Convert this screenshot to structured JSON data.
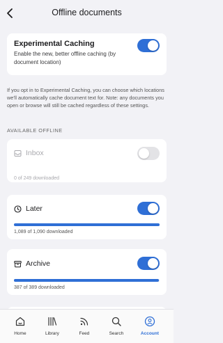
{
  "header": {
    "title": "Offline documents"
  },
  "experimental": {
    "title": "Experimental Caching",
    "description": "Enable the new, better offline caching (by document location)",
    "enabled": true
  },
  "info_text": "If you opt in to Experimental Caching, you can choose which locations we'll automatically cache document text for. Note: any documents you open or browse will still be cached regardless of these settings.",
  "section_label": "AVAILABLE OFFLINE",
  "locations": [
    {
      "name": "Inbox",
      "icon": "inbox-icon",
      "enabled": false,
      "count": "0 of 249 downloaded",
      "progress": 0
    },
    {
      "name": "Later",
      "icon": "clock-icon",
      "enabled": true,
      "count": "1,089 of 1,090 downloaded",
      "progress": 0.999
    },
    {
      "name": "Archive",
      "icon": "archive-icon",
      "enabled": true,
      "count": "387 of 389 downloaded",
      "progress": 0.995
    }
  ],
  "tabs": [
    {
      "label": "Home",
      "icon": "home-icon",
      "active": false
    },
    {
      "label": "Library",
      "icon": "library-icon",
      "active": false
    },
    {
      "label": "Feed",
      "icon": "feed-icon",
      "active": false
    },
    {
      "label": "Search",
      "icon": "search-icon",
      "active": false
    },
    {
      "label": "Account",
      "icon": "account-icon",
      "active": true
    }
  ],
  "colors": {
    "accent": "#2f6fd6",
    "background": "#f2f2f6"
  }
}
